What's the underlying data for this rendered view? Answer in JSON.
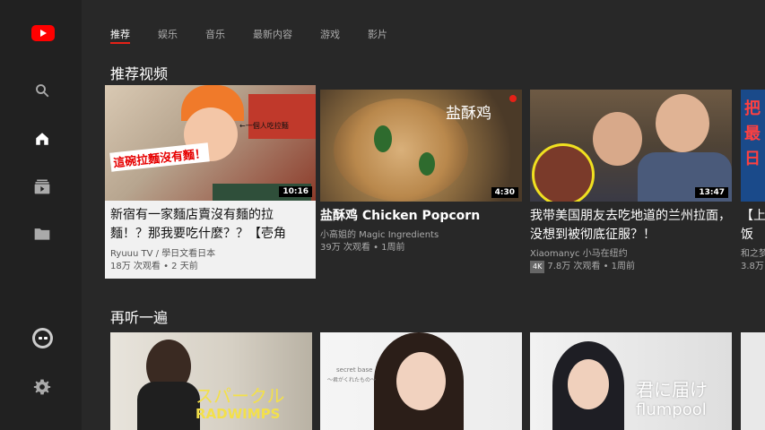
{
  "tabs": [
    {
      "label": "推荐"
    },
    {
      "label": "娱乐"
    },
    {
      "label": "音乐"
    },
    {
      "label": "最新内容"
    },
    {
      "label": "游戏"
    },
    {
      "label": "影片"
    }
  ],
  "sidebar": {
    "icons": [
      "youtube-logo",
      "search-icon",
      "home-icon",
      "subscriptions-icon",
      "library-folder-icon",
      "account-avatar",
      "settings-gear-icon"
    ]
  },
  "sections": {
    "recommended": {
      "title": "推荐视频",
      "cards": [
        {
          "title": "新宿有一家麵店賣沒有麵的拉麵！？那我要吃什麼？？【壱角",
          "channel": "Ryuuu TV / 學日文看日本",
          "meta": "18万 次观看 • 2 天前",
          "duration": "10:16",
          "thumb_caption": "這碗拉麵沒有麵！",
          "thumb_note": "←一個人吃拉麵"
        },
        {
          "title": "盐酥鸡 Chicken Popcorn",
          "channel": "小高姐的 Magic Ingredients",
          "meta": "39万 次观看 • 1周前",
          "duration": "4:30",
          "thumb_caption": "盐酥鸡"
        },
        {
          "title": "我带美国朋友去吃地道的兰州拉面，没想到被彻底征服？！",
          "channel": "Xiaomanyc 小马在纽约",
          "badge": "4K",
          "meta": "7.8万 次观看 • 1周前",
          "duration": "13:47"
        },
        {
          "title": "【上饭太",
          "meta": "和之梦",
          "meta2": "3.8万",
          "thumb_caption": "把最日"
        }
      ]
    },
    "replay": {
      "title": "再听一遍",
      "cards": [
        {
          "thumb_caption": "スパークル",
          "thumb_caption2": "RADWIMPS"
        },
        {
          "thumb_caption": "secret base",
          "thumb_caption2": "〜君がくれたもの〜"
        },
        {
          "thumb_caption": "君に届け",
          "thumb_caption2": "flumpool"
        }
      ]
    }
  },
  "colors": {
    "background": "#282828",
    "sidebar": "#212121",
    "accent": "#e62117"
  }
}
